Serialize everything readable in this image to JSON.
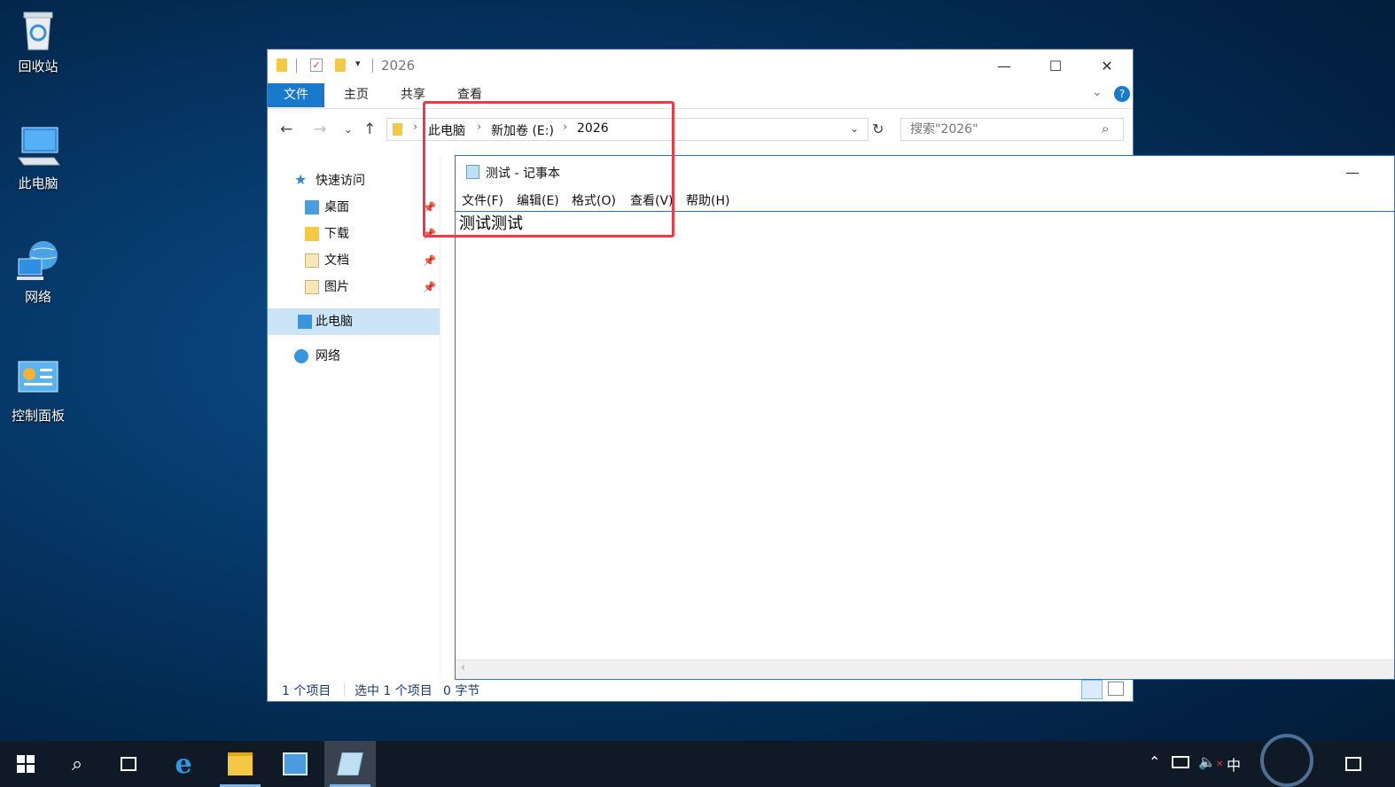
{
  "desktop": {
    "icons": [
      {
        "label": "回收站",
        "icon": "recycle-bin-icon"
      },
      {
        "label": "此电脑",
        "icon": "computer-icon"
      },
      {
        "label": "网络",
        "icon": "network-icon"
      },
      {
        "label": "控制面板",
        "icon": "control-panel-icon"
      }
    ]
  },
  "explorer": {
    "title": "2026",
    "ribbon_tabs": [
      "文件",
      "主页",
      "共享",
      "查看"
    ],
    "breadcrumb": [
      "此电脑",
      "新加卷 (E:)",
      "2026"
    ],
    "search_placeholder": "搜索\"2026\"",
    "nav": {
      "quick_access": "快速访问",
      "items": [
        "桌面",
        "下载",
        "文档",
        "图片"
      ],
      "this_pc": "此电脑",
      "network": "网络"
    },
    "status": {
      "item_count": "1 个项目",
      "selected": "选中 1 个项目",
      "size": "0 字节"
    }
  },
  "notepad": {
    "title": "测试 - 记事本",
    "menu": [
      "文件(F)",
      "编辑(E)",
      "格式(O)",
      "查看(V)",
      "帮助(H)"
    ],
    "content": "测试测试"
  },
  "taskbar": {
    "ime": "中",
    "clock_time": "",
    "clock_date": ""
  },
  "colors": {
    "accent": "#1979ca",
    "highlight": "#ef3a45",
    "taskbar": "#101a26"
  }
}
